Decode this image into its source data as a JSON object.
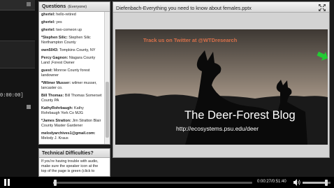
{
  "left_strip": {
    "time_text": "0:00:00]"
  },
  "questions": {
    "title": "Questions",
    "subtitle": "(Everyone)",
    "items": [
      {
        "who": "ghertel:",
        "text": "hello-retired"
      },
      {
        "who": "ghertel:",
        "text": "yes"
      },
      {
        "who": "ghertel:",
        "text": "two-comeon up"
      },
      {
        "who": "*Stephen Silic:",
        "text": "Stephen Silic Northampton County"
      },
      {
        "who": "own5043:",
        "text": "Tompkins County, NY"
      },
      {
        "who": "Percy Gagnon:",
        "text": "Niagara County Land ,Forest Owner"
      },
      {
        "who": "guest:",
        "text": "Monroe County forest landowner"
      },
      {
        "who": "*Wilmer Musser:",
        "text": "wilmer musser, lancaster co."
      },
      {
        "who": "Bill Thomas:",
        "text": "Bill Thomas  Somerset County PA"
      },
      {
        "who": "KathyRohrbaugh:",
        "text": "Kathy Rohrbaugh York Co MJG"
      },
      {
        "who": "*James Stratton:",
        "text": "Jim Stratton Blair County Master Gardener"
      },
      {
        "who": "melodyarchives1@gmail.com:",
        "text": "Melody J. Kraus"
      }
    ]
  },
  "technical": {
    "title": "Technical Difficulties?",
    "text": "If you're having trouble with audio, make sure the speaker icon at the top of the page is green (click to"
  },
  "presentation": {
    "title": "Diefenbach-Everything you need to know about females.pptx",
    "twitter_text": "Track us on Twitter at @WTDresearch",
    "blog_title": "The Deer-Forest Blog",
    "blog_url": "http://ecosystems.psu.edu/deer"
  },
  "player": {
    "timecode": "0:00:27/0:51:40",
    "progress_fraction": 0.009,
    "volume_fraction": 0.85
  },
  "colors": {
    "accent_green": "#22cc33",
    "twitter_orange": "#d9704a"
  }
}
